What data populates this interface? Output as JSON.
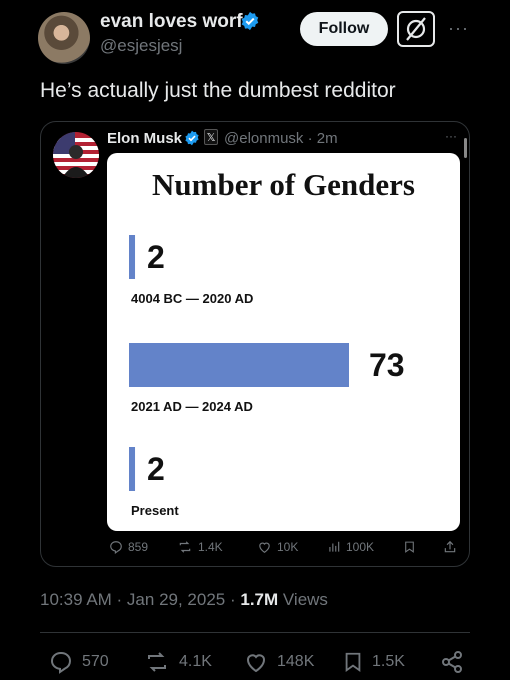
{
  "tweet": {
    "author_name": "evan loves worf",
    "handle": "@esjesjesj",
    "follow_label": "Follow",
    "text": "He’s actually just the dumbest redditor",
    "timestamp": "10:39 AM · Jan 29, 2025 · ",
    "views_count": "1.7M",
    "views_label": " Views",
    "actions": {
      "replies": "570",
      "reposts": "4.1K",
      "likes": "148K",
      "bookmarks": "1.5K"
    }
  },
  "quote": {
    "author_name": "Elon Musk",
    "x_badge": "𝕏",
    "handle_time": "@elonmusk · 2m",
    "actions": {
      "replies": "859",
      "reposts": "1.4K",
      "likes": "10K",
      "views": "100K"
    }
  },
  "colors": {
    "bar": "#6383c9",
    "verified": "#1d9bf0",
    "background": "#000000"
  },
  "chart_data": {
    "type": "bar",
    "title": "Number of Genders",
    "categories": [
      "4004 BC — 2020 AD",
      "2021 AD — 2024 AD",
      "Present"
    ],
    "values": [
      2,
      73,
      2
    ],
    "value_labels": [
      "2",
      "73",
      "2"
    ],
    "orientation": "horizontal",
    "xlim": [
      0,
      73
    ]
  }
}
